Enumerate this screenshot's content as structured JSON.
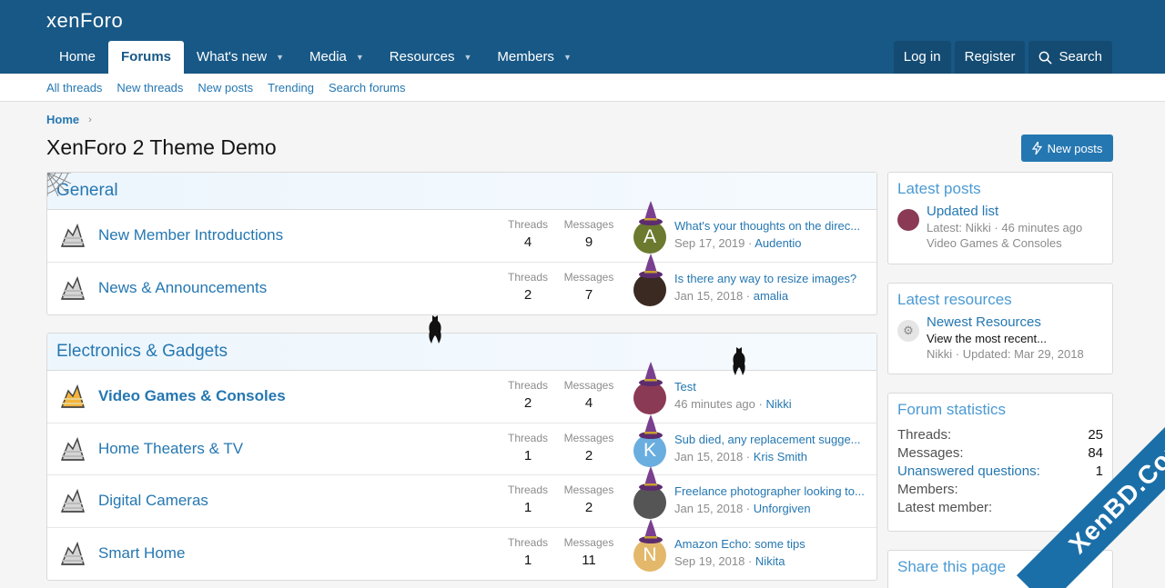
{
  "header": {
    "logo": "xenForo",
    "nav": [
      {
        "label": "Home",
        "has_caret": false
      },
      {
        "label": "Forums",
        "has_caret": false,
        "active": true
      },
      {
        "label": "What's new",
        "has_caret": true
      },
      {
        "label": "Media",
        "has_caret": true
      },
      {
        "label": "Resources",
        "has_caret": true
      },
      {
        "label": "Members",
        "has_caret": true
      }
    ],
    "login_label": "Log in",
    "register_label": "Register",
    "search_label": "Search"
  },
  "subnav": [
    "All threads",
    "New threads",
    "New posts",
    "Trending",
    "Search forums"
  ],
  "breadcrumb": "Home",
  "page_title": "XenForo 2 Theme Demo",
  "new_posts_button": "New posts",
  "categories": [
    {
      "title": "General",
      "nodes": [
        {
          "title": "New Member Introductions",
          "threads_label": "Threads",
          "threads": "4",
          "messages_label": "Messages",
          "messages": "9",
          "avatar_letter": "A",
          "avatar_color": "#6b7a2e",
          "last_title": "What's your thoughts on the direc...",
          "last_date": "Sep 17, 2019",
          "last_user": "Audentio",
          "unread": false
        },
        {
          "title": "News & Announcements",
          "threads_label": "Threads",
          "threads": "2",
          "messages_label": "Messages",
          "messages": "7",
          "avatar_letter": "",
          "avatar_color": "#3a2a22",
          "last_title": "Is there any way to resize images?",
          "last_date": "Jan 15, 2018",
          "last_user": "amalia",
          "unread": false
        }
      ]
    },
    {
      "title": "Electronics & Gadgets",
      "nodes": [
        {
          "title": "Video Games & Consoles",
          "threads_label": "Threads",
          "threads": "2",
          "messages_label": "Messages",
          "messages": "4",
          "avatar_letter": "",
          "avatar_color": "#8b3a55",
          "last_title": "Test",
          "last_date": "46 minutes ago",
          "last_user": "Nikki",
          "unread": true
        },
        {
          "title": "Home Theaters & TV",
          "threads_label": "Threads",
          "threads": "1",
          "messages_label": "Messages",
          "messages": "2",
          "avatar_letter": "K",
          "avatar_color": "#6aaee0",
          "last_title": "Sub died, any replacement sugge...",
          "last_date": "Jan 15, 2018",
          "last_user": "Kris Smith",
          "unread": false
        },
        {
          "title": "Digital Cameras",
          "threads_label": "Threads",
          "threads": "1",
          "messages_label": "Messages",
          "messages": "2",
          "avatar_letter": "",
          "avatar_color": "#555555",
          "last_title": "Freelance photographer looking to...",
          "last_date": "Jan 15, 2018",
          "last_user": "Unforgiven",
          "unread": false
        },
        {
          "title": "Smart Home",
          "threads_label": "Threads",
          "threads": "1",
          "messages_label": "Messages",
          "messages": "11",
          "avatar_letter": "N",
          "avatar_color": "#e3b86a",
          "last_title": "Amazon Echo: some tips",
          "last_date": "Sep 19, 2018",
          "last_user": "Nikita",
          "unread": false
        }
      ]
    }
  ],
  "sidebar": {
    "latest_posts": {
      "title": "Latest posts",
      "item_title": "Updated list",
      "item_meta": "Latest: Nikki · 46 minutes ago",
      "item_forum": "Video Games & Consoles"
    },
    "latest_resources": {
      "title": "Latest resources",
      "item_title": "Newest Resources",
      "item_desc": "View the most recent...",
      "item_meta": "Nikki · Updated: Mar 29, 2018"
    },
    "forum_stats": {
      "title": "Forum statistics",
      "rows": [
        {
          "label": "Threads:",
          "value": "25"
        },
        {
          "label": "Messages:",
          "value": "84"
        },
        {
          "label": "Unanswered questions:",
          "value": "1"
        },
        {
          "label": "Members:",
          "value": ""
        },
        {
          "label": "Latest member:",
          "value": ""
        }
      ]
    },
    "share": {
      "title": "Share this page"
    }
  },
  "watermark": "XenBD.Com",
  "colors": {
    "header": "#185886",
    "link": "#2577b1",
    "accent": "#4b9ad3"
  }
}
